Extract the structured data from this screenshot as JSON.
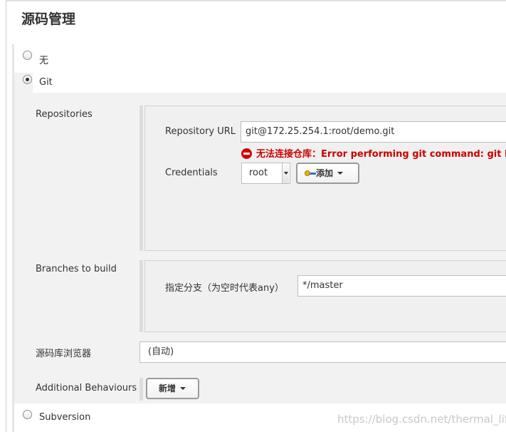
{
  "section": {
    "title": "源码管理"
  },
  "scm": {
    "options": [
      {
        "label": "无",
        "selected": false
      },
      {
        "label": "Git",
        "selected": true
      },
      {
        "label": "Subversion",
        "selected": false
      }
    ]
  },
  "git": {
    "repositories": {
      "label": "Repositories",
      "url_label": "Repository URL",
      "url_value": "git@172.25.254.1:root/demo.git",
      "error_text": "无法连接仓库：Error performing git command: git ls-",
      "credentials_label": "Credentials",
      "credentials_value": "root",
      "add_button": "添加"
    },
    "branches": {
      "label": "Branches to build",
      "branch_label": "指定分支（为空时代表any）",
      "branch_value": "*/master"
    },
    "browser": {
      "label": "源码库浏览器",
      "value": "(自动)"
    },
    "behaviours": {
      "label": "Additional Behaviours",
      "add_button": "新增"
    }
  },
  "watermark": "https://blog.csdn.net/thermal_life",
  "colors": {
    "error": "#cc0000",
    "panel_bg": "#f2f2f2",
    "inner_bg": "#f0f0f0"
  }
}
